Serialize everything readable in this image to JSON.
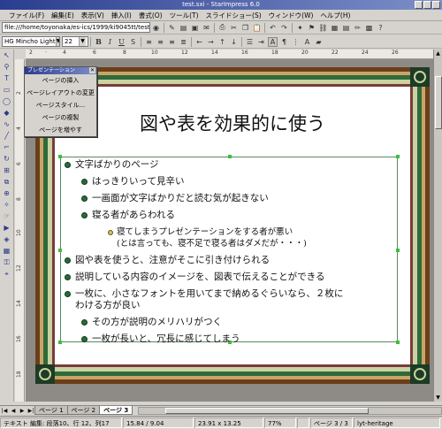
{
  "window": {
    "title": "test.sxi - StarImpress 6.0"
  },
  "menu": [
    "ファイル(F)",
    "編集(E)",
    "表示(V)",
    "挿入(I)",
    "書式(O)",
    "ツール(T)",
    "スライドショー(S)",
    "ウィンドウ(W)",
    "ヘルプ(H)"
  ],
  "toolbar": {
    "url": "file:///home/toyonaka/es-ics/1999/ki9045tt/test..."
  },
  "format": {
    "font_name": "HG Mincho Light",
    "font_size": "22",
    "bold": "B",
    "italic": "I",
    "underline": "U"
  },
  "ruler": {
    "h_ticks": [
      "2",
      "·",
      "4",
      "6",
      "8",
      "10",
      "12",
      "14",
      "16",
      "18",
      "20",
      "22",
      "24",
      "26"
    ],
    "v_ticks": [
      "2",
      "4",
      "6",
      "8",
      "10",
      "12",
      "14",
      "16",
      "18"
    ]
  },
  "nav_panel": {
    "title": "プレゼンテーション",
    "items": [
      "ページの挿入",
      "ページレイアウトの変更",
      "ページスタイル...",
      "ページの複製",
      "ページを増やす"
    ]
  },
  "slide": {
    "title": "図や表を効果的に使う",
    "bullets": [
      {
        "level": 1,
        "text": "文字ばかりのページ"
      },
      {
        "level": 2,
        "text": "はっきりいって見辛い"
      },
      {
        "level": 2,
        "text": "一画面が文字ばかりだと読む気が起きない"
      },
      {
        "level": 2,
        "text": "寝る者があらわれる"
      },
      {
        "level": 3,
        "text": "寝てしまうプレゼンテーションをする者が悪い"
      },
      {
        "level": 3,
        "text": "(とは言っても、寝不足で寝る者はダメだが・・・)"
      },
      {
        "level": 1,
        "text": "図や表を使うと、注意がそこに引き付けられる"
      },
      {
        "level": 1,
        "text": "説明している内容のイメージを、図表で伝えることができる"
      },
      {
        "level": 1,
        "text": "一枚に、小さなフォントを用いてまで納めるぐらいなら、２枚に"
      },
      {
        "level": 1,
        "text": "わける方が良い"
      },
      {
        "level": 2,
        "text": "その方が説明のメリハリがつく"
      },
      {
        "level": 2,
        "text": "一枚が長いと、冗長に感じてしまう"
      }
    ]
  },
  "tabs": [
    "ページ 1",
    "ページ 2",
    "ページ 3"
  ],
  "status": {
    "mode": "テキスト 編集: 段落10、行 12、列17",
    "position": "15.84 / 9.04",
    "size": "23.91 x 13.25",
    "zoom": "77%",
    "page": "ページ 3 / 3",
    "layout": "lyt-heritage"
  }
}
